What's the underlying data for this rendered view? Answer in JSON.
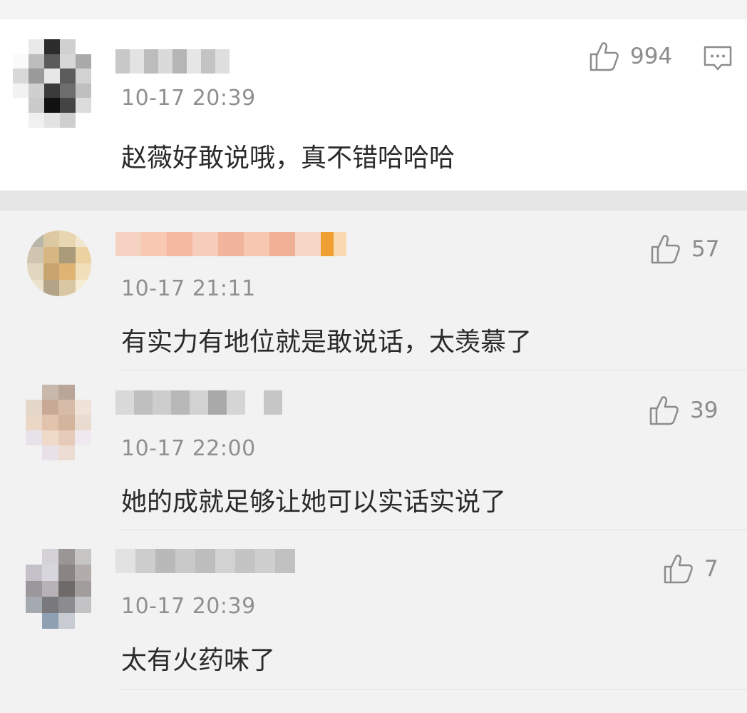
{
  "main_comment": {
    "timestamp": "10-17 20:39",
    "text": "赵薇好敢说哦，真不错哈哈哈",
    "likes": "994"
  },
  "replies": [
    {
      "timestamp": "10-17 21:11",
      "text": "有实力有地位就是敢说话，太羡慕了",
      "likes": "57"
    },
    {
      "timestamp": "10-17 22:00",
      "text": "她的成就足够让她可以实话实说了",
      "likes": "39"
    },
    {
      "timestamp": "10-17 20:39",
      "text": "太有火药味了",
      "likes": "7"
    }
  ],
  "icons": {
    "like": "thumbs-up-icon",
    "reply": "comment-bubble-icon"
  },
  "colors": {
    "meta_text": "#8f8f8f",
    "body_text": "#2a2a2a",
    "reply_background": "#f2f2f2"
  }
}
